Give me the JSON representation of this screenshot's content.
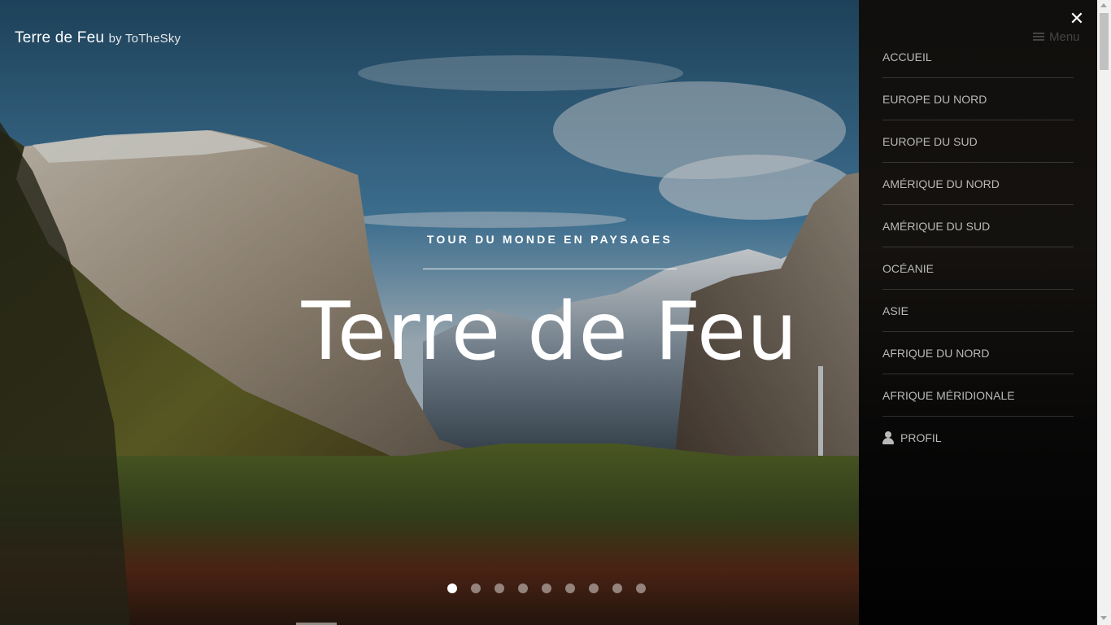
{
  "brand": {
    "name": "Terre de Feu",
    "by": "by ToTheSky"
  },
  "hero": {
    "tagline": "TOUR DU MONDE EN PAYSAGES",
    "title": "Terre de Feu",
    "slides_total": 9,
    "active_slide": 1
  },
  "menu": {
    "toggle_label": "Menu",
    "close_icon": "close-icon",
    "items": [
      {
        "label": "ACCUEIL"
      },
      {
        "label": "EUROPE DU NORD"
      },
      {
        "label": "EUROPE DU SUD"
      },
      {
        "label": "AMÉRIQUE DU NORD"
      },
      {
        "label": "AMÉRIQUE DU SUD"
      },
      {
        "label": "OCÉANIE"
      },
      {
        "label": "ASIE"
      },
      {
        "label": "AFRIQUE DU NORD"
      },
      {
        "label": "AFRIQUE MÉRIDIONALE"
      },
      {
        "label": "PROFIL",
        "icon": "user-icon"
      }
    ]
  },
  "colors": {
    "menu_text": "#b9b9b9",
    "menu_bg": "#141210",
    "hero_text": "#ffffff"
  }
}
